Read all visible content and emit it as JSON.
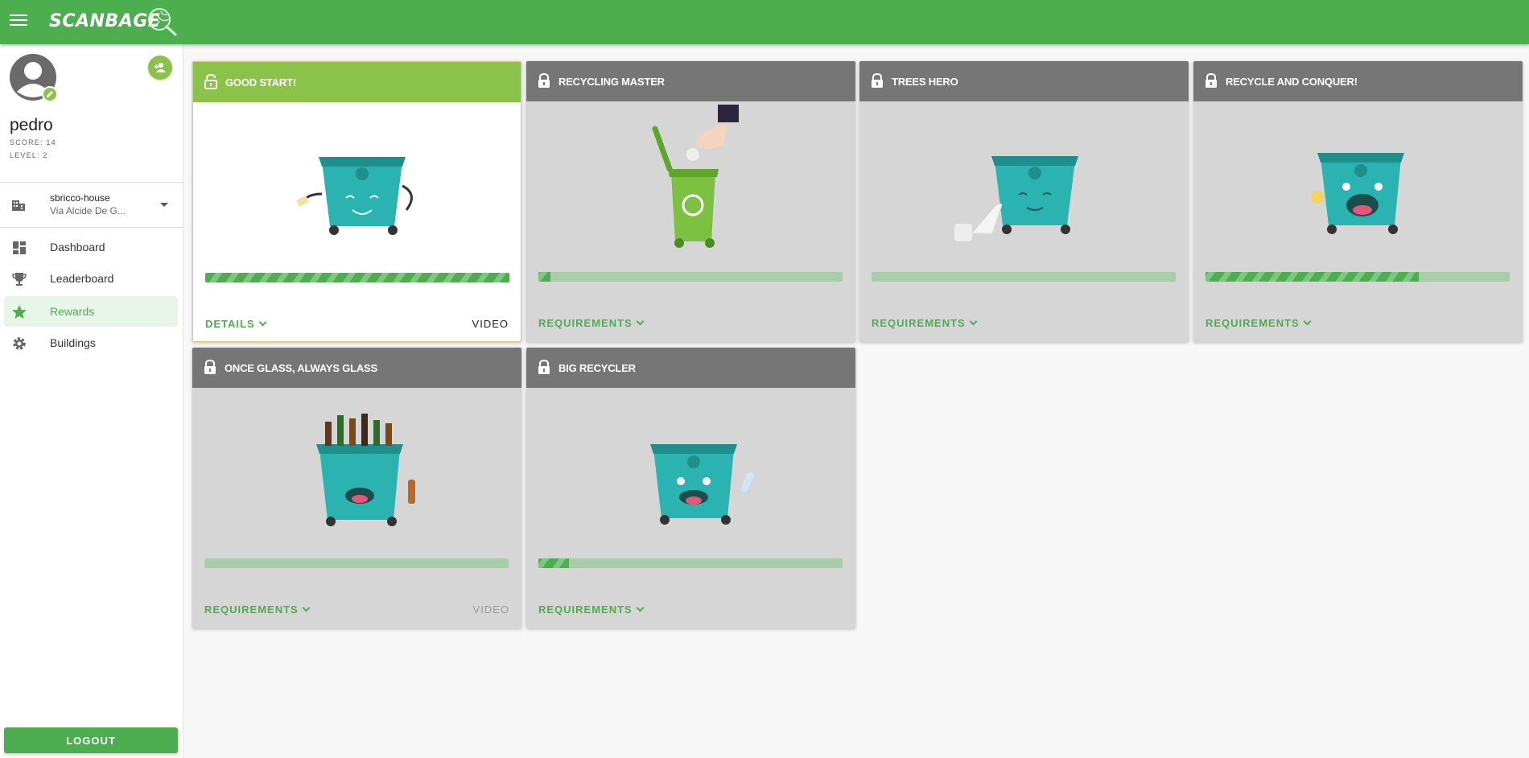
{
  "app": {
    "brand": "SCANBAGE"
  },
  "profile": {
    "username": "pedro",
    "score_text": "SCORE: 14",
    "level_text": "LEVEL: 2"
  },
  "building": {
    "name": "sbricco-house",
    "address": "Via Alcide De G..."
  },
  "nav": [
    {
      "label": "Dashboard",
      "icon": "dashboard-icon"
    },
    {
      "label": "Leaderboard",
      "icon": "trophy-icon"
    },
    {
      "label": "Rewards",
      "icon": "star-icon",
      "active": true
    },
    {
      "label": "Buildings",
      "icon": "gear-icon"
    }
  ],
  "logout_label": "LOGOUT",
  "rewards": [
    {
      "title": "GOOD START!",
      "unlocked": true,
      "progress": 1.0,
      "action": "DETAILS",
      "video": "VIDEO",
      "image": "happy-bin-cleaning-image"
    },
    {
      "title": "RECYCLING MASTER",
      "unlocked": false,
      "progress": 0.04,
      "action": "REQUIREMENTS",
      "image": "green-bin-hand-image"
    },
    {
      "title": "TREES HERO",
      "unlocked": false,
      "progress": 0.0,
      "action": "REQUIREMENTS",
      "image": "bin-toilet-paper-image"
    },
    {
      "title": "RECYCLE AND CONQUER!",
      "unlocked": false,
      "progress": 0.7,
      "action": "REQUIREMENTS",
      "image": "bin-shouting-image"
    },
    {
      "title": "ONCE GLASS, ALWAYS GLASS",
      "unlocked": false,
      "progress": 0.0,
      "action": "REQUIREMENTS",
      "video": "VIDEO",
      "video_disabled": true,
      "image": "bin-bottles-image"
    },
    {
      "title": "BIG RECYCLER",
      "unlocked": false,
      "progress": 0.1,
      "action": "REQUIREMENTS",
      "image": "bin-plastic-bottle-image"
    }
  ],
  "colors": {
    "primary": "#4cae4f",
    "accent": "#8bc34a",
    "locked_header": "#767676",
    "teal_bin": "#2bb3b1"
  }
}
